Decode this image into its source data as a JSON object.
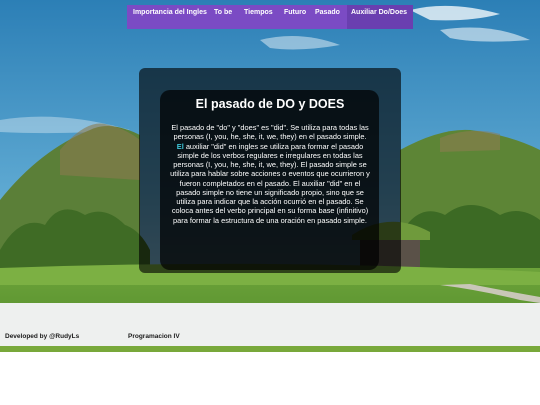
{
  "nav": {
    "items": [
      "Importancia del Ingles",
      "To be",
      "Tiempos",
      "Futuro",
      "Pasado",
      "Auxiliar Do/Does"
    ]
  },
  "main": {
    "title": "El pasado de DO y DOES",
    "paragraph1": "El pasado de \"do\" y \"does\" es \"did\". Se utiliza para todas las personas (I, you, he, she, it, we, they) en el pasado simple.",
    "paragraph2_highlight": "El",
    "paragraph2_rest": " auxiliar \"did\" en ingles se utiliza para formar el pasado simple de los verbos regulares e irregulares en todas las personas (I, you, he, she, it, we, they). El pasado simple se utiliza para hablar sobre acciones o eventos que ocurrieron y fueron completados en el pasado. El auxiliar \"did\" en el pasado simple no tiene un significado propio, sino que se utiliza para indicar que la acción ocurrió en el pasado. Se coloca antes del verbo principal en su forma base (infinitivo) para formar la estructura de una oración en pasado simple."
  },
  "footer": {
    "left": "Developed by @RudyLs",
    "right": "Programacion IV"
  },
  "colors": {
    "nav_background": "#7b4bc4",
    "highlight": "#3ec7d8"
  }
}
